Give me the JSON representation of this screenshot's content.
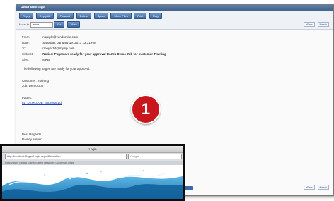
{
  "mail": {
    "title": "Read Message",
    "toolbar": [
      "Reply",
      "Reply All",
      "Forward",
      "Delete",
      "Spam",
      "Move Files",
      "Print",
      "Flag"
    ],
    "nav": {
      "label": "Move to",
      "folder": "Inbox",
      "btn1": "Go",
      "btn2": "View"
    },
    "pager": {
      "prev": "«Prev",
      "next": "Next»"
    },
    "headers": [
      {
        "key": "From:",
        "value": "noreply@vendorsite.com",
        "bold": false
      },
      {
        "key": "Date:",
        "value": "Saturday, January 19, 2013 12:31 PM",
        "bold": false
      },
      {
        "key": "To:",
        "value": "rmeyer14@myisp.com",
        "bold": false
      },
      {
        "key": "Subject:",
        "value": "Notice: Pages are ready for your approval to Job Demo Job for customer Training",
        "bold": true
      },
      {
        "key": "Size:",
        "value": "8 KB",
        "bold": false
      }
    ],
    "body": {
      "intro": "The following pages are ready for your approval:",
      "customer_label": "Customer:",
      "customer_value": "Training",
      "job_label": "Job:",
      "job_value": "Demo Job",
      "pages_label": "Pages:",
      "pages_link": "p1_DEMOJOB_approval.pdf",
      "regards": "Best Regards",
      "signature": "Rainey Meyer"
    },
    "bottom_pager": {
      "prev": "«Prev",
      "next": "Next»"
    }
  },
  "callout": {
    "number": "1"
  },
  "login": {
    "title": "Login",
    "address": "http://localhost/Pages/Login.aspx?ReturnUrl=",
    "search_placeholder": "Google",
    "bookmarks": "Most Visited   Getting Started   Latest Headlines   Customize Links"
  }
}
